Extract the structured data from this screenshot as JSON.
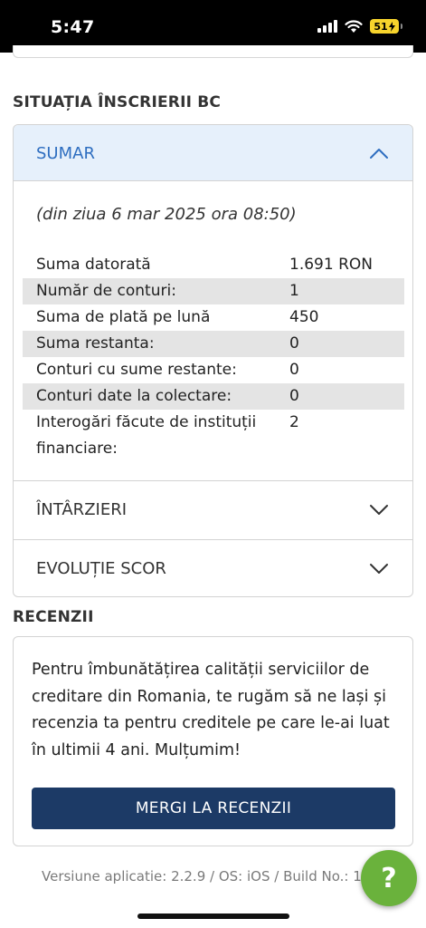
{
  "status_bar": {
    "time": "5:47",
    "battery": "51"
  },
  "enrollment": {
    "section_title": "SITUAȚIA ÎNSCRIERII BC",
    "summary_header": "SUMAR",
    "date_line": "(din ziua 6 mar 2025 ora 08:50)",
    "rows": [
      {
        "label": "Suma datorată",
        "value": "1.691 RON"
      },
      {
        "label": "Număr de conturi:",
        "value": "1"
      },
      {
        "label": "Suma de plată pe lună",
        "value": "450"
      },
      {
        "label": "Suma restanta:",
        "value": "0"
      },
      {
        "label": "Conturi cu sume restante:",
        "value": "0"
      },
      {
        "label": "Conturi date la colectare:",
        "value": "0"
      },
      {
        "label": "Interogări făcute de instituții financiare:",
        "value": "2"
      }
    ],
    "delays_label": "ÎNTÂRZIERI",
    "score_label": "EVOLUȚIE SCOR"
  },
  "reviews": {
    "section_title": "RECENZII",
    "text": "Pentru îmbunătățirea calității serviciilor de creditare din Romania, te rugăm să ne lași și recenzia ta pentru creditele pe care le-ai luat în ultimii 4 ani. Mulțumim!",
    "button_label": "MERGI LA RECENZII"
  },
  "footer": {
    "version": "Versiune aplicatie: 2.2.9 / OS: iOS / Build No.: 1",
    "help_label": "?"
  },
  "colors": {
    "accent_blue": "#2e6ec0",
    "header_bg": "#e6f0fb",
    "button_navy": "#1c3a66",
    "help_green": "#6ab23c",
    "battery_yellow": "#f7d42c"
  }
}
